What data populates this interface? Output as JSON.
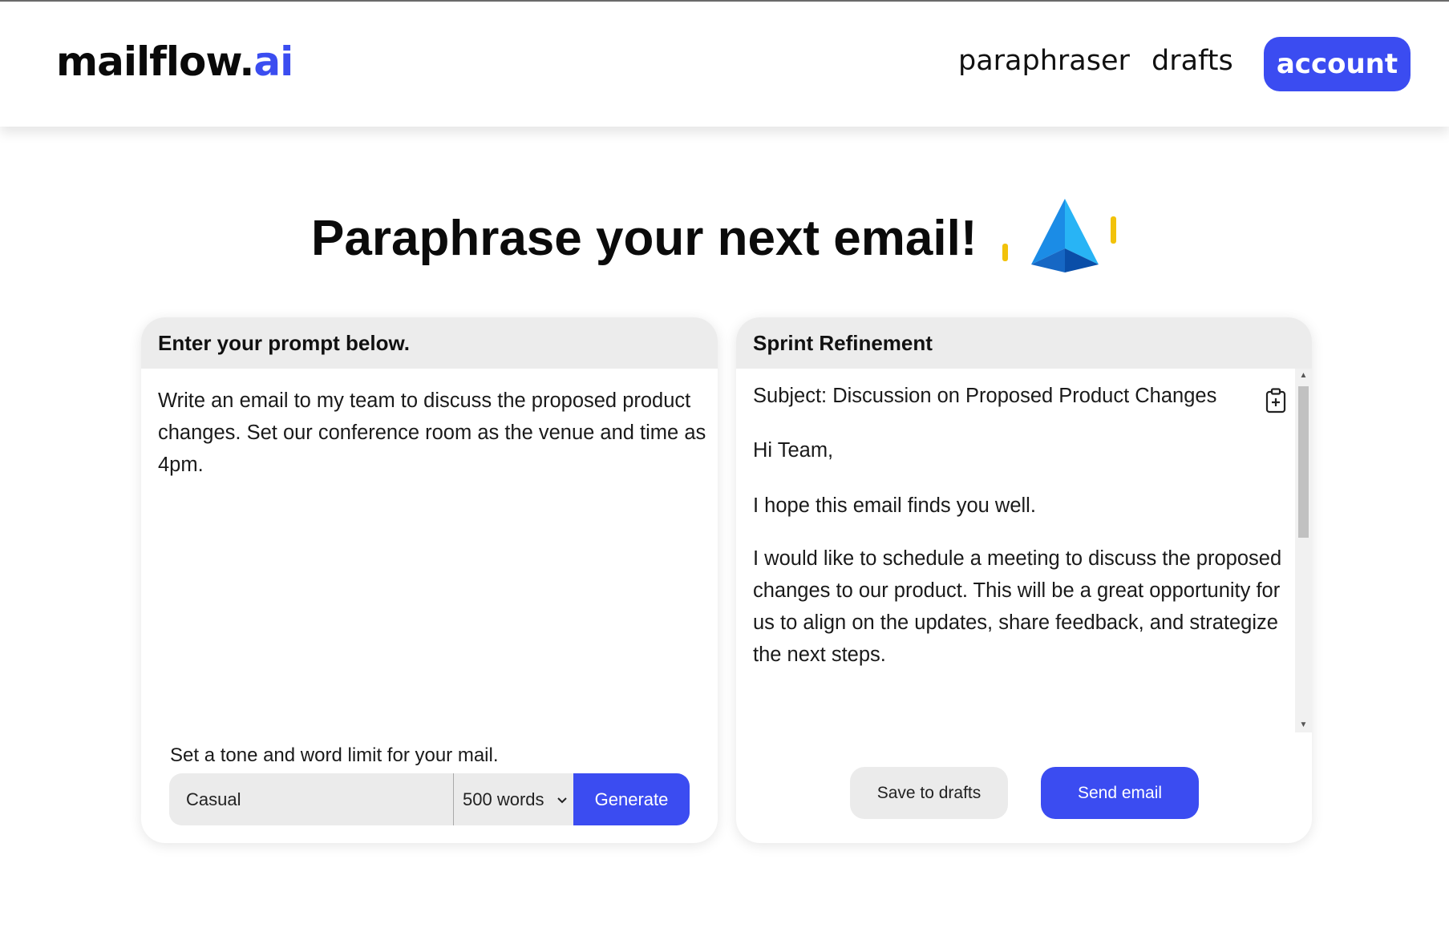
{
  "app": {
    "logo_main": "mailflow.",
    "logo_accent": "ai",
    "accent_color": "#3b4cf1"
  },
  "nav": {
    "links": [
      "paraphraser",
      "drafts"
    ],
    "account_label": "account"
  },
  "hero": {
    "title": "Paraphrase your next email!",
    "icon": "paper-plane-icon"
  },
  "prompt_card": {
    "header": "Enter your prompt below.",
    "prompt_text": "Write an email to my team to discuss the proposed product changes. Set our conference room as the venue and time as 4pm.",
    "tone_label": "Set a tone and word limit for your mail.",
    "tone_value": "Casual",
    "word_limit": "500 words",
    "generate_label": "Generate"
  },
  "output_card": {
    "header": "Sprint Refinement",
    "subject": "Subject: Discussion on Proposed Product Changes",
    "greeting": "Hi Team,",
    "line1": "I hope this email finds you well.",
    "paragraph": "I would like to schedule a meeting to discuss the proposed changes to our product. This will be a great opportunity for us to align on the updates, share feedback, and strategize the next steps.",
    "copy_icon": "clipboard-plus-icon",
    "save_label": "Save to drafts",
    "send_label": "Send email"
  }
}
